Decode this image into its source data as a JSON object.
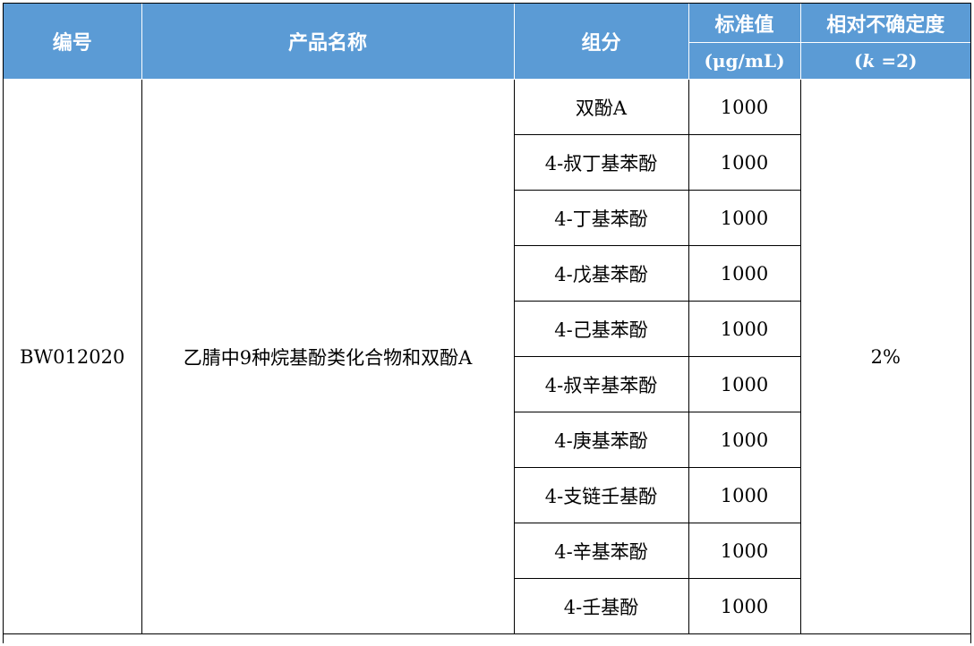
{
  "header": {
    "code": "编号",
    "product_name": "产品名称",
    "component": "组分",
    "standard_value": "标准值",
    "standard_unit": "(μg/mL)",
    "uncertainty": "相对不确定度",
    "uncertainty_k_prefix": "(",
    "uncertainty_k_var": "k",
    "uncertainty_k_suffix": " =2)"
  },
  "product": {
    "code": "BW012020",
    "name": "乙腈中9种烷基酚类化合物和双酚A",
    "uncertainty": "2%"
  },
  "components": [
    {
      "name": "双酚A",
      "value": "1000"
    },
    {
      "name": "4-叔丁基苯酚",
      "value": "1000"
    },
    {
      "name": "4-丁基苯酚",
      "value": "1000"
    },
    {
      "name": "4-戊基苯酚",
      "value": "1000"
    },
    {
      "name": "4-己基苯酚",
      "value": "1000"
    },
    {
      "name": "4-叔辛基苯酚",
      "value": "1000"
    },
    {
      "name": "4-庚基苯酚",
      "value": "1000"
    },
    {
      "name": "4-支链壬基酚",
      "value": "1000"
    },
    {
      "name": "4-辛基苯酚",
      "value": "1000"
    },
    {
      "name": "4-壬基酚",
      "value": "1000"
    }
  ],
  "colors": {
    "header_bg": "#5b9bd5",
    "header_text": "#ffffff",
    "border": "#000000"
  }
}
